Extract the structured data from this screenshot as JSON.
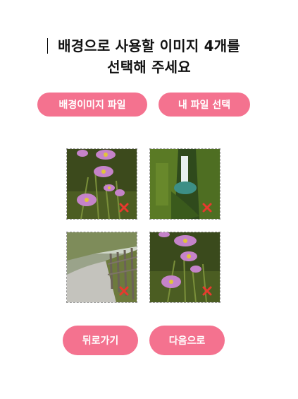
{
  "page": {
    "title_line1": "배경으로 사용할 이미지 4개를",
    "title_line2": "선택해 주세요"
  },
  "source_buttons": {
    "default_images": "배경이미지 파일",
    "my_files": "내 파일 선택"
  },
  "images": [
    {
      "subject": "pink cosmos flowers",
      "remove_icon": "close-icon"
    },
    {
      "subject": "waterfall in green canyon",
      "remove_icon": "close-icon"
    },
    {
      "subject": "path with wooden fence",
      "remove_icon": "close-icon"
    },
    {
      "subject": "pink cosmos flowers",
      "remove_icon": "close-icon"
    }
  ],
  "nav_buttons": {
    "back": "뒤로가기",
    "next": "다음으로"
  },
  "colors": {
    "accent": "#f4728f",
    "remove_x": "#e8392e"
  }
}
